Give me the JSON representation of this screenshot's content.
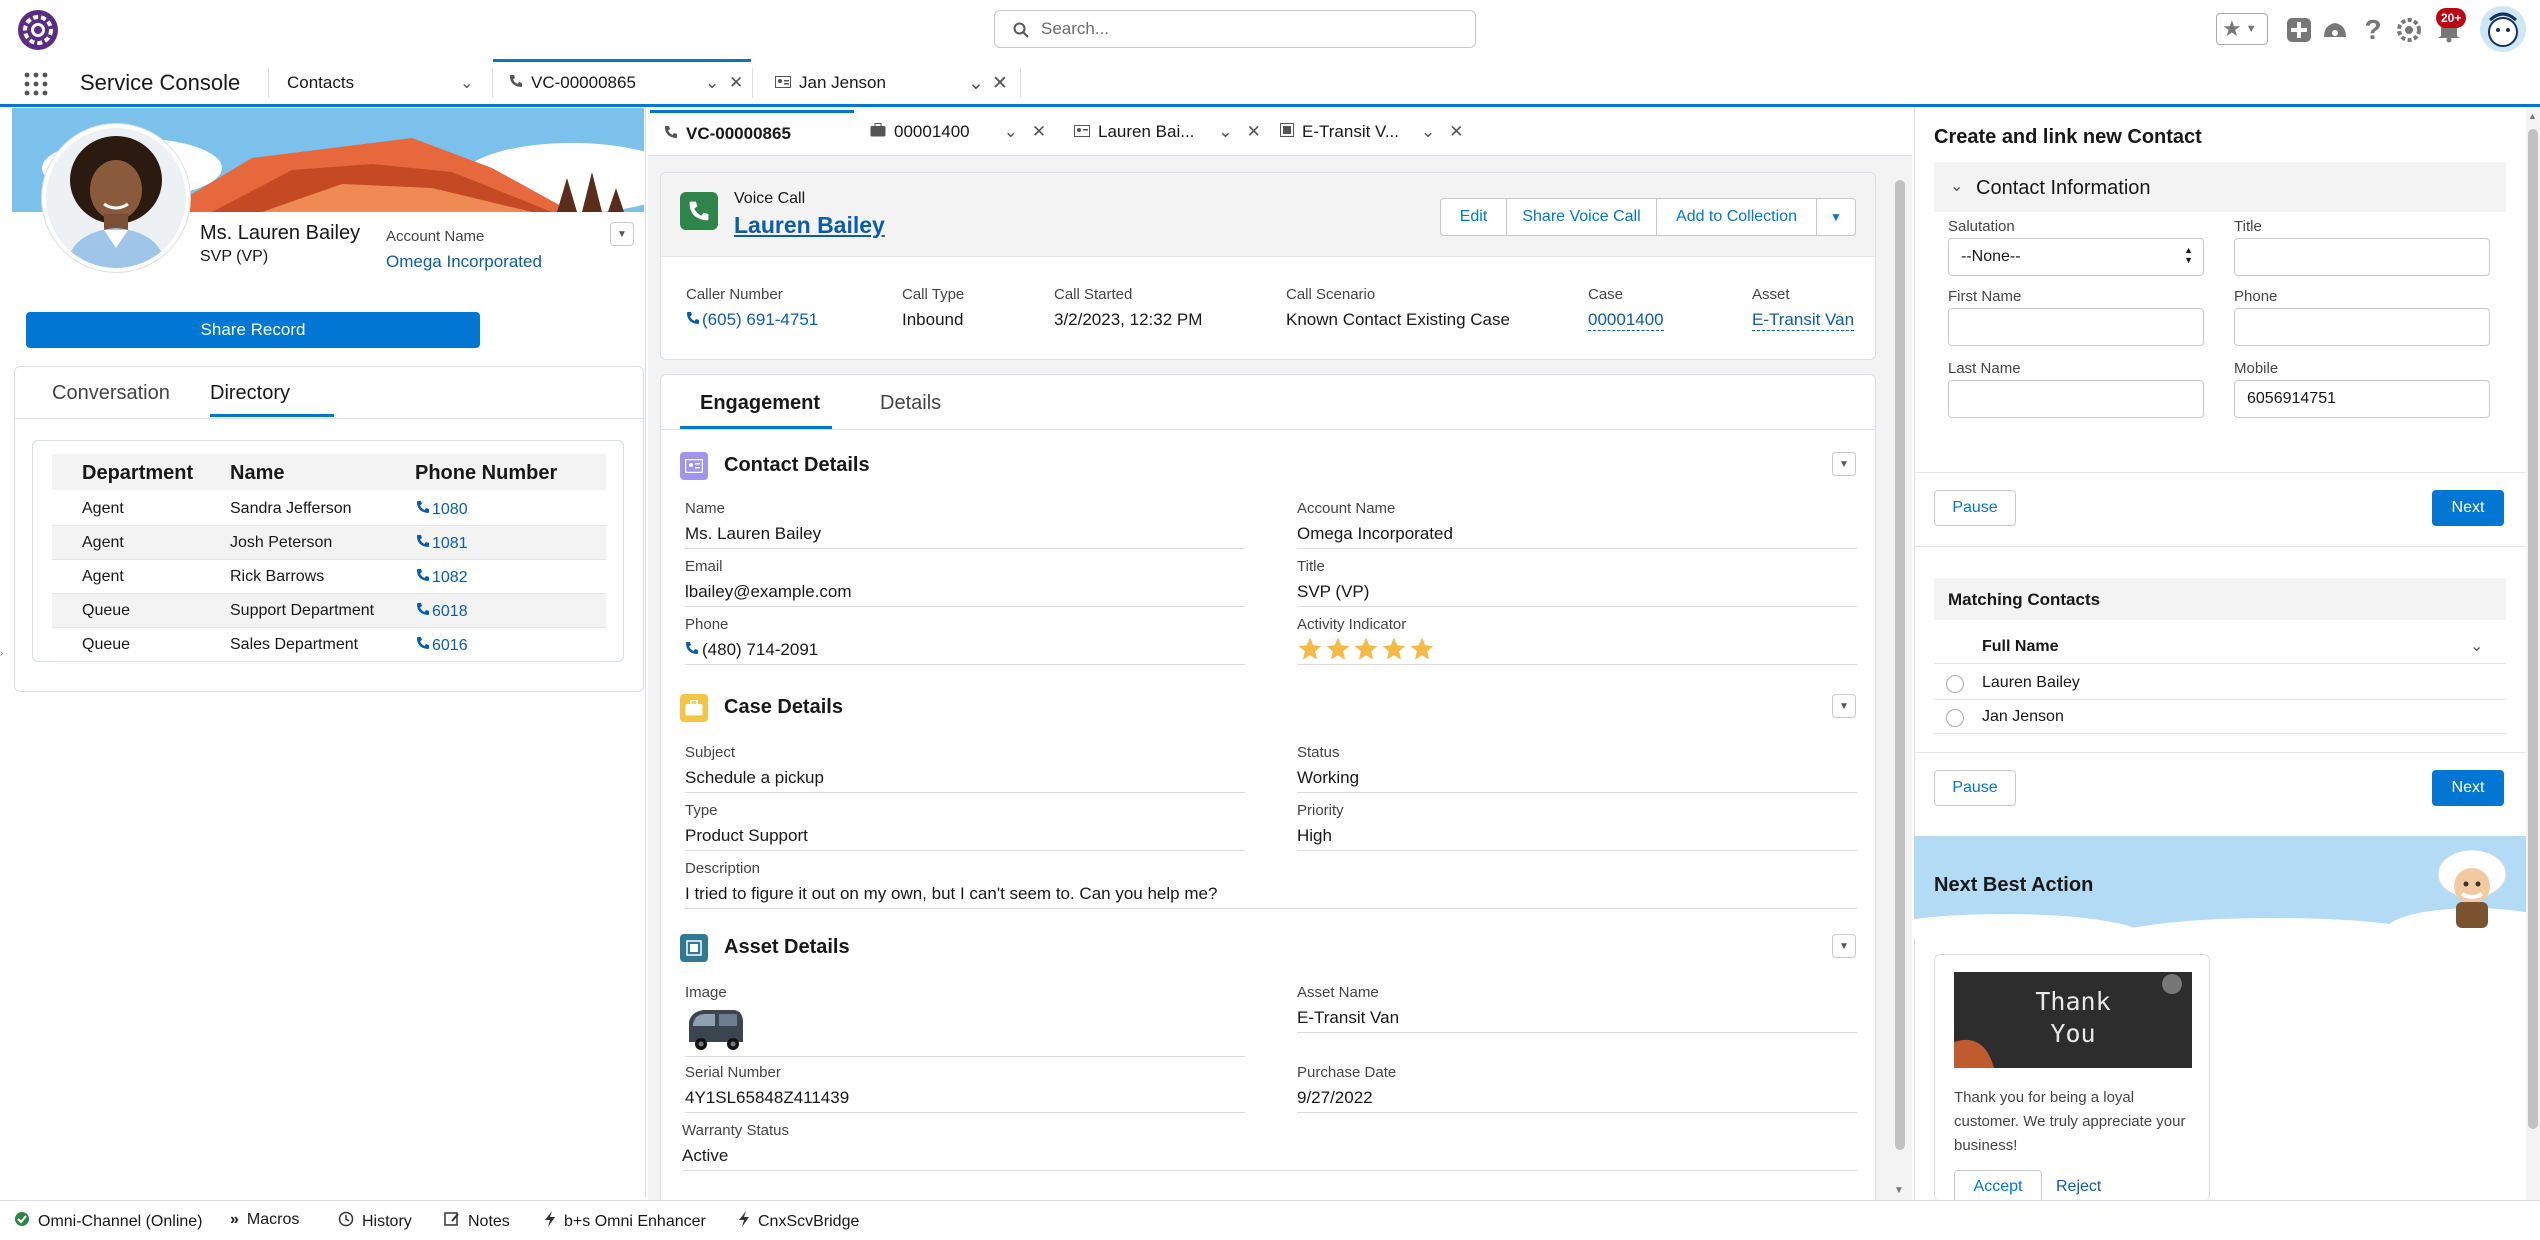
{
  "search": {
    "placeholder": "Search..."
  },
  "header": {
    "notif_badge": "20+"
  },
  "nav": {
    "app_name": "Service Console",
    "tabs": [
      {
        "label": "Contacts"
      },
      {
        "label": "VC-00000865"
      },
      {
        "label": "Jan Jenson"
      }
    ]
  },
  "profile": {
    "name": "Ms. Lauren Bailey",
    "title": "SVP (VP)",
    "account_label": "Account Name",
    "account_value": "Omega Incorporated",
    "share_button": "Share Record"
  },
  "left_tabs": {
    "conversation": "Conversation",
    "directory": "Directory"
  },
  "directory": {
    "headers": [
      "Department",
      "Name",
      "Phone Number"
    ],
    "rows": [
      {
        "dept": "Agent",
        "name": "Sandra Jefferson",
        "phone": "1080"
      },
      {
        "dept": "Agent",
        "name": "Josh Peterson",
        "phone": "1081"
      },
      {
        "dept": "Agent",
        "name": "Rick Barrows",
        "phone": "1082"
      },
      {
        "dept": "Queue",
        "name": "Support Department",
        "phone": "6018"
      },
      {
        "dept": "Queue",
        "name": "Sales Department",
        "phone": "6016"
      }
    ]
  },
  "subtabs": [
    {
      "label": "VC-00000865"
    },
    {
      "label": "00001400"
    },
    {
      "label": "Lauren Bai..."
    },
    {
      "label": "E-Transit V..."
    }
  ],
  "voice_call": {
    "object_label": "Voice Call",
    "name": "Lauren Bailey",
    "actions": {
      "edit": "Edit",
      "share": "Share Voice Call",
      "add": "Add to Collection"
    },
    "fields": [
      {
        "label": "Caller Number",
        "value": "(605) 691-4751"
      },
      {
        "label": "Call Type",
        "value": "Inbound"
      },
      {
        "label": "Call Started",
        "value": "3/2/2023, 12:32 PM"
      },
      {
        "label": "Call Scenario",
        "value": "Known Contact Existing Case"
      },
      {
        "label": "Case",
        "value": "00001400"
      },
      {
        "label": "Asset",
        "value": "E-Transit Van"
      }
    ]
  },
  "record_tabs": {
    "engagement": "Engagement",
    "details": "Details"
  },
  "contact_details": {
    "title": "Contact Details",
    "name_label": "Name",
    "name_value": "Ms. Lauren Bailey",
    "account_label": "Account Name",
    "account_value": "Omega Incorporated",
    "email_label": "Email",
    "email_value": "lbailey@example.com",
    "title_label": "Title",
    "title_value": "SVP (VP)",
    "phone_label": "Phone",
    "phone_value": "(480) 714-2091",
    "activity_label": "Activity Indicator",
    "activity_stars": 5
  },
  "case_details": {
    "title": "Case Details",
    "subject_label": "Subject",
    "subject_value": "Schedule a pickup",
    "status_label": "Status",
    "status_value": "Working",
    "type_label": "Type",
    "type_value": "Product Support",
    "priority_label": "Priority",
    "priority_value": "High",
    "desc_label": "Description",
    "desc_value": "I tried to figure it out on my own, but I can't seem to. Can you help me?"
  },
  "asset_details": {
    "title": "Asset Details",
    "image_label": "Image",
    "asset_name_label": "Asset Name",
    "asset_name_value": "E-Transit Van",
    "serial_label": "Serial Number",
    "serial_value": "4Y1SL65848Z411439",
    "purchase_label": "Purchase Date",
    "purchase_value": "9/27/2022",
    "warranty_label": "Warranty Status",
    "warranty_value": "Active"
  },
  "create_contact": {
    "title": "Create and link new Contact",
    "section": "Contact Information",
    "salutation_label": "Salutation",
    "salutation_value": "--None--",
    "title_label": "Title",
    "first_label": "First Name",
    "phone_label": "Phone",
    "last_label": "Last Name",
    "mobile_label": "Mobile",
    "mobile_value": "6056914751",
    "pause": "Pause",
    "next": "Next"
  },
  "matching": {
    "title": "Matching Contacts",
    "column": "Full Name",
    "rows": [
      "Lauren Bailey",
      "Jan Jenson"
    ],
    "pause": "Pause",
    "next": "Next"
  },
  "nba": {
    "title": "Next Best Action",
    "card_image_text_1": "Thank",
    "card_image_text_2": "You",
    "message": "Thank you for being a loyal customer. We truly appreciate your business!",
    "accept": "Accept",
    "reject": "Reject"
  },
  "footer": [
    {
      "label": "Omni-Channel (Online)"
    },
    {
      "label": "Macros"
    },
    {
      "label": "History"
    },
    {
      "label": "Notes"
    },
    {
      "label": "b+s Omni Enhancer"
    },
    {
      "label": "CnxScvBridge"
    }
  ],
  "colors": {
    "brand": "#0176d3",
    "link": "#0b5cab",
    "star": "#f5b945",
    "call_green": "#2e844a"
  }
}
